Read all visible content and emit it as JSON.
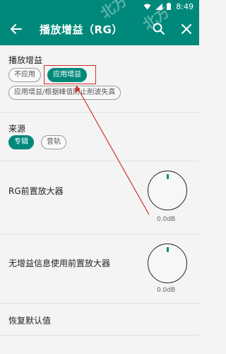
{
  "status_bar": {
    "time": "8:49"
  },
  "app_bar": {
    "title": "播放增益（RG）"
  },
  "replay_gain": {
    "title": "播放增益",
    "options": [
      "不应用",
      "应用增益",
      "应用增益/根据峰值防止削波失真"
    ],
    "selected": "应用增益"
  },
  "source": {
    "title": "来源",
    "options": [
      "专辑",
      "音轨"
    ],
    "selected": "专辑"
  },
  "rg_preamp": {
    "label": "RG前置放大器",
    "value": "0.0dB"
  },
  "no_gain_preamp": {
    "label": "无增益信息使用前置放大器",
    "value": "0.0dB"
  },
  "reset": {
    "label": "恢复默认值"
  },
  "colors": {
    "accent": "#00897b",
    "annotation": "#d32f2f"
  }
}
